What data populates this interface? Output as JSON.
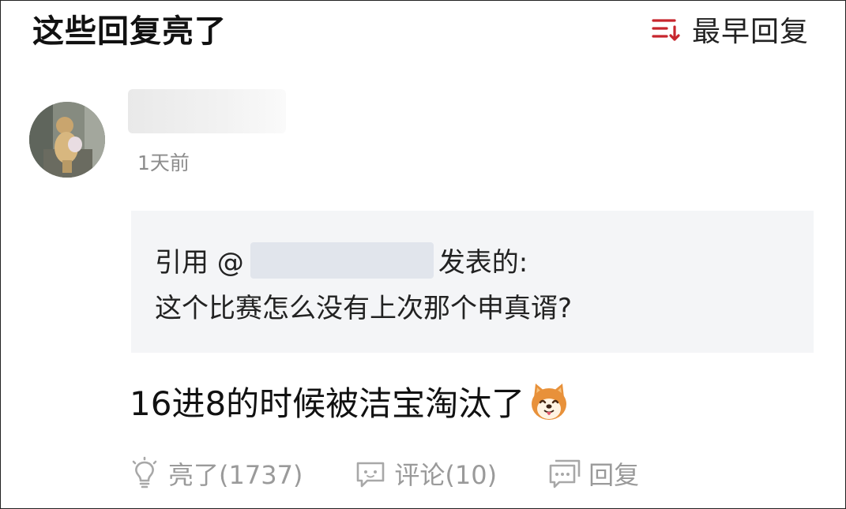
{
  "header": {
    "title": "这些回复亮了",
    "sort_label": "最早回复",
    "sort_icon": "sort-descending-icon",
    "accent_color": "#c7262d"
  },
  "post": {
    "timestamp": "1天前",
    "quote": {
      "prefix": "引用 @",
      "suffix": "发表的:",
      "text": "这个比赛怎么没有上次那个申真谞?"
    },
    "body": "16进8的时候被洁宝淘汰了",
    "emoji": "shiba-dog-emoji",
    "actions": {
      "like_label": "亮了(1737)",
      "comment_label": "评论(10)",
      "reply_label": "回复"
    }
  }
}
